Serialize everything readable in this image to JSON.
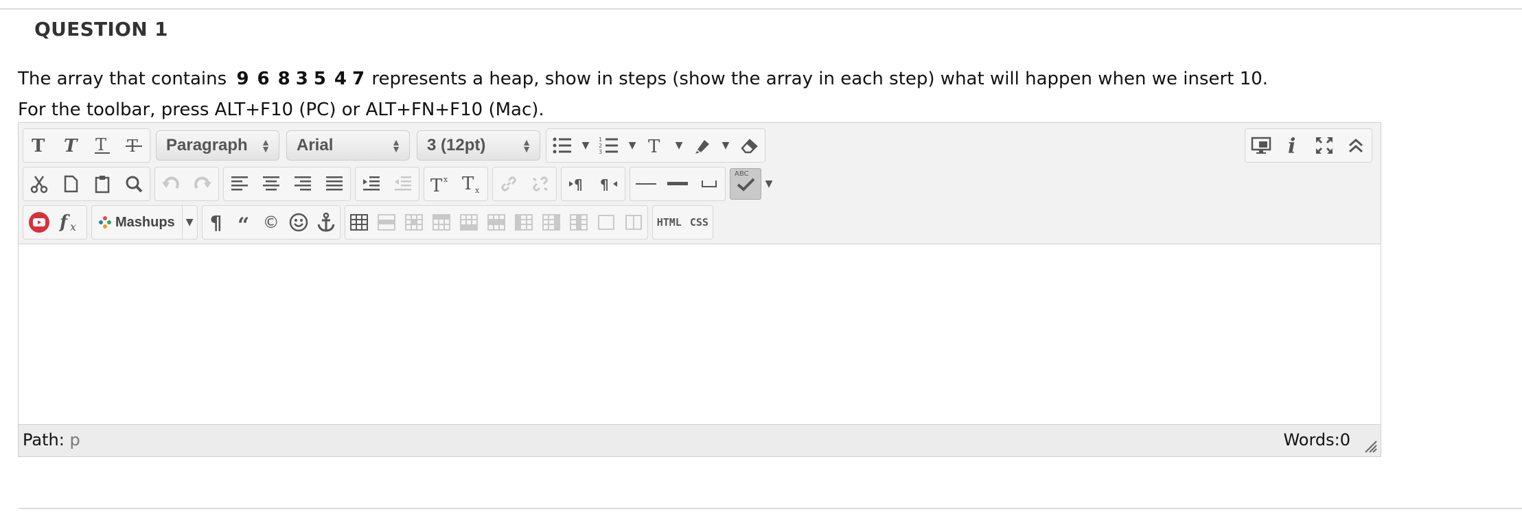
{
  "question": {
    "title": "QUESTION 1",
    "text_before": "The array that contains",
    "array": [
      "9",
      "6",
      "8",
      "3",
      "5",
      "4",
      "7"
    ],
    "text_after": "represents a heap, show in steps (show the array in each step) what will happen when we insert 10.",
    "toolbar_hint": "For the toolbar, press ALT+F10 (PC) or ALT+FN+F10 (Mac)."
  },
  "toolbar": {
    "format_select": "Paragraph",
    "font_select": "Arial",
    "size_select": "3 (12pt)",
    "mashups_label": "Mashups",
    "html_label": "HTML",
    "css_label": "CSS",
    "spell_label": "ABC"
  },
  "statusbar": {
    "path_label": "Path:",
    "path_value": "p",
    "words": "Words:0"
  },
  "colors": {
    "youtube": "#d7313b",
    "mashup_dots": [
      "#e74c3c",
      "#27ae60",
      "#2980b9",
      "#f39c12"
    ]
  }
}
